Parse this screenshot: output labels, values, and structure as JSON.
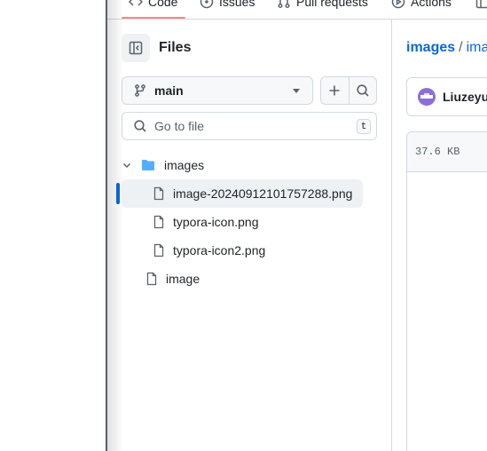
{
  "nav": {
    "tabs": [
      {
        "label": "Code",
        "icon": "code-icon"
      },
      {
        "label": "Issues",
        "icon": "issue-icon"
      },
      {
        "label": "Pull requests",
        "icon": "pull-request-icon"
      },
      {
        "label": "Actions",
        "icon": "actions-icon"
      }
    ]
  },
  "panel": {
    "title": "Files",
    "branch": "main",
    "goto_placeholder": "Go to file",
    "goto_shortcut": "t"
  },
  "tree": {
    "folder": "images",
    "files": [
      {
        "name": "image-20240912101757288.png",
        "selected": true
      },
      {
        "name": "typora-icon.png",
        "selected": false
      },
      {
        "name": "typora-icon2.png",
        "selected": false
      }
    ],
    "root_file": "image"
  },
  "content": {
    "breadcrumb_folder": "images",
    "breadcrumb_separator": "/",
    "breadcrumb_current": "ima",
    "author": "Liuzeyu",
    "file_size": "37.6 KB"
  },
  "colors": {
    "accent": "#0969da",
    "tab_underline": "#fd8c73",
    "folder": "#54aeff",
    "border": "#d1d9e0"
  }
}
